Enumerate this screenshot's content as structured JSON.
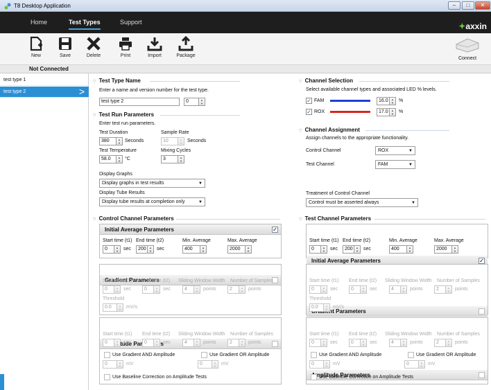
{
  "window": {
    "title": "T8 Desktop Application",
    "min": "–",
    "max": "□",
    "close": "✕"
  },
  "ribbon": {
    "tabs": [
      "Home",
      "Test Types",
      "Support"
    ],
    "logo": "axxin"
  },
  "toolbar": {
    "new": "New",
    "save": "Save",
    "delete": "Delete",
    "print": "Print",
    "import": "Import",
    "package": "Package",
    "connect": "Connect"
  },
  "status": "Not Connected",
  "sidebar": {
    "items": [
      "test type 1",
      "test type 2"
    ]
  },
  "test_type_name": {
    "header": "Test Type Name",
    "desc": "Enter a name and version number for the test type.",
    "name": "test type 2",
    "version": "0"
  },
  "run_params": {
    "header": "Test Run Parameters",
    "desc": "Enter test run parameters.",
    "duration_label": "Test Duration",
    "duration": "380",
    "duration_unit": "Seconds",
    "rate_label": "Sample Rate",
    "rate": "10",
    "rate_unit": "Seconds",
    "temp_label": "Test Temperature",
    "temp": "58.0",
    "temp_unit": "°C",
    "mix_label": "Mixing Cycles",
    "mix": "3",
    "graphs_label": "Display Graphs",
    "graphs": "Display graphs in test results",
    "tube_label": "Display Tube Results",
    "tube": "Display tube results at completion only"
  },
  "channel_selection": {
    "header": "Channel Selection",
    "desc": "Select available channel types and associated LED % levels.",
    "channels": [
      {
        "name": "FAM",
        "value": "16.0",
        "unit": "%",
        "color": "#1f3fd0"
      },
      {
        "name": "ROX",
        "value": "17.0",
        "unit": "%",
        "color": "#d8261a"
      }
    ]
  },
  "channel_assignment": {
    "header": "Channel Assignment",
    "desc": "Assign channels to the appropriate functionality.",
    "control_label": "Control Channel",
    "control": "ROX",
    "test_label": "Test Channel",
    "test": "FAM",
    "treatment_label": "Treatment of Control Channel",
    "treatment": "Control must be asserted always"
  },
  "control": {
    "header": "Control Channel Parameters",
    "initial": {
      "title": "Initial Average Parameters",
      "start_label": "Start time (t1)",
      "start": "0",
      "end_label": "End time (t2)",
      "end": "200",
      "unit": "sec",
      "min_label": "Min. Average",
      "min": "400",
      "max_label": "Max. Average",
      "max": "2000"
    },
    "gradient": {
      "title": "Gradient Parameters",
      "start_label": "Start time (t1)",
      "start": "0",
      "end_label": "End time (t2)",
      "end": "0",
      "unit": "sec",
      "win_label": "Sliding Window Width",
      "win": "4",
      "win_unit": "points",
      "samples_label": "Number of Samples",
      "samples": "2",
      "samples_unit": "points",
      "thr_label": "Threshold",
      "thr": "0.0",
      "thr_unit": "mV/s"
    },
    "amplitude": {
      "title": "Amplitude Parameters",
      "start_label": "Start time (t1)",
      "start": "0",
      "end_label": "End time (t2)",
      "end": "0",
      "unit": "sec",
      "win_label": "Sliding Window Width",
      "win": "4",
      "win_unit": "points",
      "samples_label": "Number of Samples",
      "samples": "2",
      "samples_unit": "points",
      "and_label": "Use Gradient AND Amplitude",
      "and_val": "0",
      "or_label": "Use Gradient OR Amplitude",
      "or_val": "0",
      "mv": "mV",
      "baseline": "Use Baseline Correction on Amplitude Tests"
    }
  },
  "test": {
    "header": "Test Channel Parameters",
    "initial": {
      "title": "Initial Average Parameters",
      "start_label": "Start time (t1)",
      "start": "0",
      "end_label": "End time (t2)",
      "end": "200",
      "unit": "sec",
      "min_label": "Min. Average",
      "min": "400",
      "max_label": "Max. Average",
      "max": "2000"
    },
    "gradient": {
      "title": "Gradient Parameters",
      "start_label": "Start time (t1)",
      "start": "0",
      "end_label": "End time (t2)",
      "end": "0",
      "unit": "sec",
      "win_label": "Sliding Window Width",
      "win": "4",
      "win_unit": "points",
      "samples_label": "Number of Samples",
      "samples": "2",
      "samples_unit": "points",
      "thr_label": "Threshold",
      "thr": "0.0",
      "thr_unit": "mV/s"
    },
    "amplitude": {
      "title": "Amplitude Parameters",
      "start_label": "Start time (t1)",
      "start": "0",
      "end_label": "End time (t2)",
      "end": "0",
      "unit": "sec",
      "win_label": "Sliding Window Width",
      "win": "4",
      "win_unit": "points",
      "samples_label": "Number of Samples",
      "samples": "2",
      "samples_unit": "points",
      "and_label": "Use Gradient AND Amplitude",
      "and_val": "0",
      "or_label": "Use Gradient OR Amplitude",
      "or_val": "0",
      "mv": "mV",
      "baseline": "Use Baseline Correction on Amplitude Tests"
    }
  }
}
